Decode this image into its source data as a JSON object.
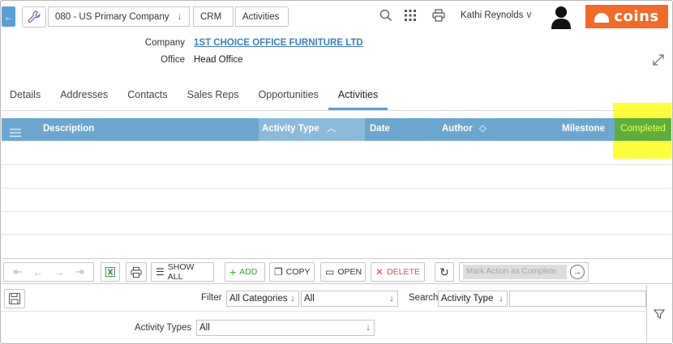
{
  "breadcrumb": {
    "company": "080 - US Primary Company",
    "module": "CRM",
    "page": "Activities"
  },
  "header": {
    "user_name": "Kathi Reynolds",
    "logo_text": "coins"
  },
  "info": {
    "company_label": "Company",
    "company_value": "1ST CHOICE OFFICE FURNITURE LTD",
    "office_label": "Office",
    "office_value": "Head Office"
  },
  "tabs": [
    {
      "label": "Details"
    },
    {
      "label": "Addresses"
    },
    {
      "label": "Contacts"
    },
    {
      "label": "Sales Reps"
    },
    {
      "label": "Opportunities"
    },
    {
      "label": "Activities"
    }
  ],
  "grid": {
    "columns": {
      "description": "Description",
      "activity_type": "Activity Type",
      "date": "Date",
      "author": "Author",
      "milestone": "Milestone",
      "completed": "Completed"
    }
  },
  "toolbar": {
    "show_all": "SHOW ALL",
    "add": "ADD",
    "copy": "COPY",
    "open": "OPEN",
    "delete": "DELETE",
    "mark_action_placeholder": "Mark Action as Complete"
  },
  "filter": {
    "filter_label": "Filter",
    "category_value": "All Categories",
    "filter_value": "All",
    "search_label": "Search",
    "search_field_value": "Activity Type",
    "search_text": "",
    "activity_types_label": "Activity Types",
    "activity_types_value": "All"
  },
  "colors": {
    "accent": "#5a9fd4",
    "grid_header": "#6da7cf",
    "sorted_column": "#8cbadb",
    "completed_column": "#5fae3d",
    "brand": "#f06a2a",
    "highlight": "#ffff00"
  }
}
